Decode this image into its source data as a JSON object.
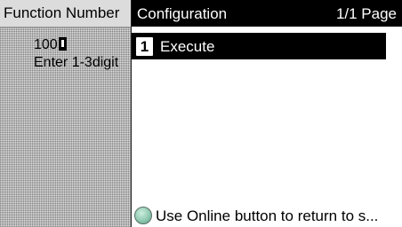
{
  "left_panel": {
    "header": "Function Number",
    "value": "100",
    "hint": "Enter 1-3digit"
  },
  "right_panel": {
    "title": "Configuration",
    "page_indicator": "1/1 Page",
    "items": [
      {
        "number": "1",
        "label": "Execute"
      }
    ],
    "status": {
      "icon": "online-led-icon",
      "text": "Use Online button to return to s..."
    }
  }
}
